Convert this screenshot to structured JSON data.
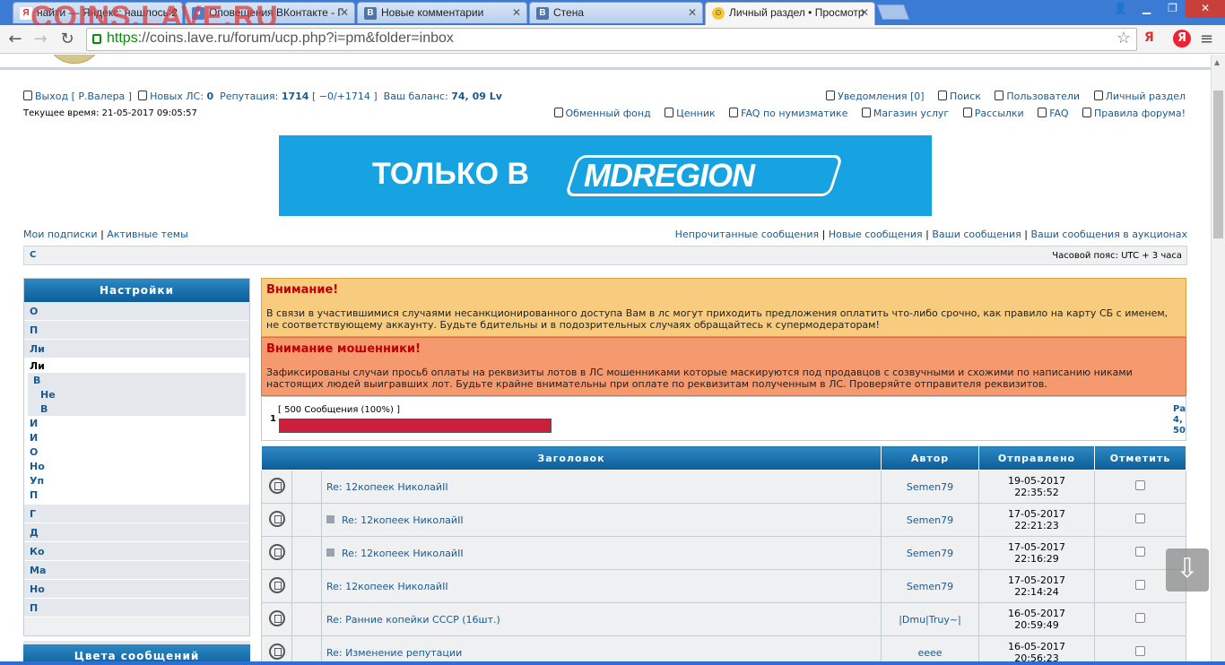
{
  "browser": {
    "tabs": [
      {
        "label": "найти — Яндекс: нашлось 2",
        "icon": "yandex"
      },
      {
        "label": "Оповещения ВКонтакте - Г",
        "icon": "generic"
      },
      {
        "label": "Новые комментарии",
        "icon": "vk"
      },
      {
        "label": "Стена",
        "icon": "vk"
      },
      {
        "label": "Личный раздел • Просмотр",
        "icon": "smiley"
      }
    ],
    "watermark": "COINS.LAVE.RU",
    "url_scheme": "https",
    "url_rest": "://coins.lave.ru/forum/ucp.php?i=pm&folder=inbox",
    "ext1": "Я",
    "ext2": "Я"
  },
  "header": {
    "logout": "Выход [ Р.Валера ]",
    "new_pm_label": "Новых ЛС:",
    "new_pm_count": "0",
    "rep_label": "Репутация:",
    "rep_value": "1714",
    "rep_detail": "[ −0/+1714 ]",
    "balance_label": "Ваш баланс:",
    "balance_value": "74, 09 Lv",
    "time": "Текущее время: 21-05-2017 09:05:57",
    "right1": [
      "Уведомления [0]",
      "Поиск",
      "Пользователи",
      "Личный раздел"
    ],
    "right2": [
      "Обменный фонд",
      "Ценник",
      "FAQ по нумизматике",
      "Магазин услуг",
      "Рассылки",
      "FAQ",
      "Правила форума!"
    ]
  },
  "banner": {
    "text1": "ТОЛЬКО В",
    "text2": "MDREGION"
  },
  "links": {
    "left": [
      "Мои подписки",
      "Активные темы"
    ],
    "right": [
      "Непрочитанные сообщения",
      "Новые сообщения",
      "Ваши сообщения",
      "Ваши сообщения в аукционах"
    ]
  },
  "strip": {
    "left": "С",
    "timezone": "Часовой пояс: UTC + 3 часа"
  },
  "sidebar": {
    "title": "Настройки",
    "top_items": [
      "О",
      "П",
      "Ли"
    ],
    "sub_title": "Ли",
    "sub_sel": "В",
    "sub_inner": [
      "Не",
      "В"
    ],
    "sub_more": [
      "И",
      "И",
      "О",
      "Но",
      "Уп",
      "П"
    ],
    "bottom_items": [
      "Г",
      "Д",
      "Ко",
      "Ма",
      "Но",
      "П"
    ],
    "title2": "Цвета сообщений"
  },
  "notices": {
    "n1_title": "Внимание!",
    "n1_text": "В связи в участившимися случаями несанкционированного доступа Вам в лс могут приходить предложения оплатить что-либо срочно, как правило на карту СБ с именем, не соответствующему аккаунту. Будьте бдительны и в подозрительных случаях обращайтесь к супермодераторам!",
    "n2_title": "Внимание мошенники!",
    "n2_text": "Зафиксированы случаи просьб оплаты на реквизиты лотов в ЛС мошенниками которые маскируются под продавцов с созвучными и схожими по написанию никами настоящих людей выигравших лот. Будьте крайне внимательны при оплате по реквизитам полученным в ЛС. Проверяйте отправителя реквизитов."
  },
  "quota": {
    "label": "[ 500 Сообщения (100%) ]",
    "one": "1",
    "percent": 100,
    "edge": "Ра 4, 50"
  },
  "table": {
    "headers": [
      "Заголовок",
      "Автор",
      "Отправлено",
      "Отметить"
    ],
    "rows": [
      {
        "title": "Re: 12копеек НиколайII",
        "author": "Semen79",
        "date": "19-05-2017",
        "time": "22:35:52",
        "marked": false
      },
      {
        "title": "Re: 12копеек НиколайII",
        "author": "Semen79",
        "date": "17-05-2017",
        "time": "22:21:23",
        "marked": true
      },
      {
        "title": "Re: 12копеек НиколайII",
        "author": "Semen79",
        "date": "17-05-2017",
        "time": "22:16:29",
        "marked": true
      },
      {
        "title": "Re: 12копеек НиколайII",
        "author": "Semen79",
        "date": "17-05-2017",
        "time": "22:14:24",
        "marked": false
      },
      {
        "title": "Re: Ранние копейки СССР (16шт.)",
        "author": "|Dmu|Truy~|",
        "date": "16-05-2017",
        "time": "20:59:49",
        "marked": false
      },
      {
        "title": "Re: Изменение репутации",
        "author": "eeee",
        "date": "16-05-2017",
        "time": "20:56:23",
        "marked": false
      }
    ]
  }
}
